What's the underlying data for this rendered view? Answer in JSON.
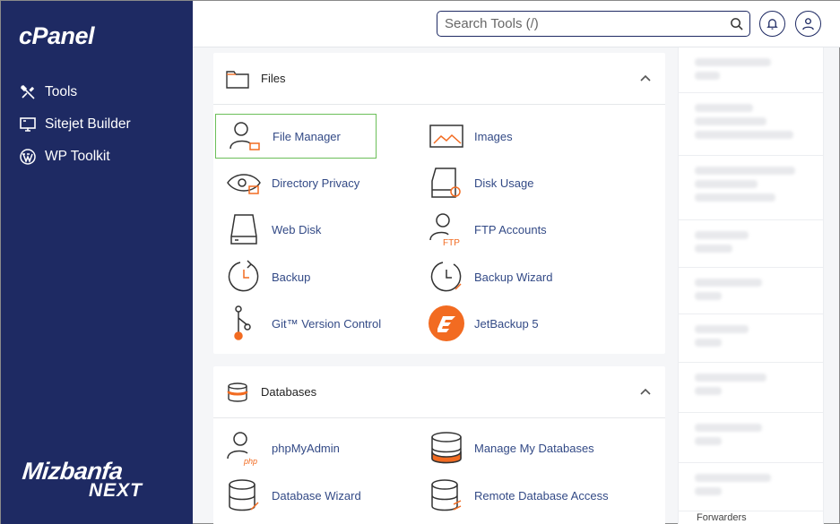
{
  "sidebar": {
    "logo": "cPanel",
    "items": [
      {
        "label": "Tools",
        "icon": "tools-icon"
      },
      {
        "label": "Sitejet Builder",
        "icon": "monitor-icon"
      },
      {
        "label": "WP Toolkit",
        "icon": "wordpress-icon"
      }
    ],
    "brand_line1": "Mizbanfa",
    "brand_line2": "NEXT"
  },
  "header": {
    "search_placeholder": "Search Tools (/)"
  },
  "files": {
    "title": "Files",
    "tools": [
      {
        "label": "File Manager",
        "icon": "file-manager-icon"
      },
      {
        "label": "Images",
        "icon": "images-icon"
      },
      {
        "label": "Directory Privacy",
        "icon": "directory-privacy-icon"
      },
      {
        "label": "Disk Usage",
        "icon": "disk-usage-icon"
      },
      {
        "label": "Web Disk",
        "icon": "web-disk-icon"
      },
      {
        "label": "FTP Accounts",
        "icon": "ftp-accounts-icon"
      },
      {
        "label": "Backup",
        "icon": "backup-icon"
      },
      {
        "label": "Backup Wizard",
        "icon": "backup-wizard-icon"
      },
      {
        "label": "Git™ Version Control",
        "icon": "git-icon"
      },
      {
        "label": "JetBackup 5",
        "icon": "jetbackup-icon"
      }
    ]
  },
  "databases": {
    "title": "Databases",
    "tools": [
      {
        "label": "phpMyAdmin",
        "icon": "phpmyadmin-icon"
      },
      {
        "label": "Manage My Databases",
        "icon": "manage-databases-icon"
      },
      {
        "label": "Database Wizard",
        "icon": "database-wizard-icon"
      },
      {
        "label": "Remote Database Access",
        "icon": "remote-database-icon"
      }
    ]
  },
  "right_panel": {
    "bottom_label": "Forwarders"
  },
  "colors": {
    "sidebar": "#1e2a63",
    "accent_orange": "#f26b21",
    "link": "#334a86",
    "selected_border": "#6bbf59"
  }
}
